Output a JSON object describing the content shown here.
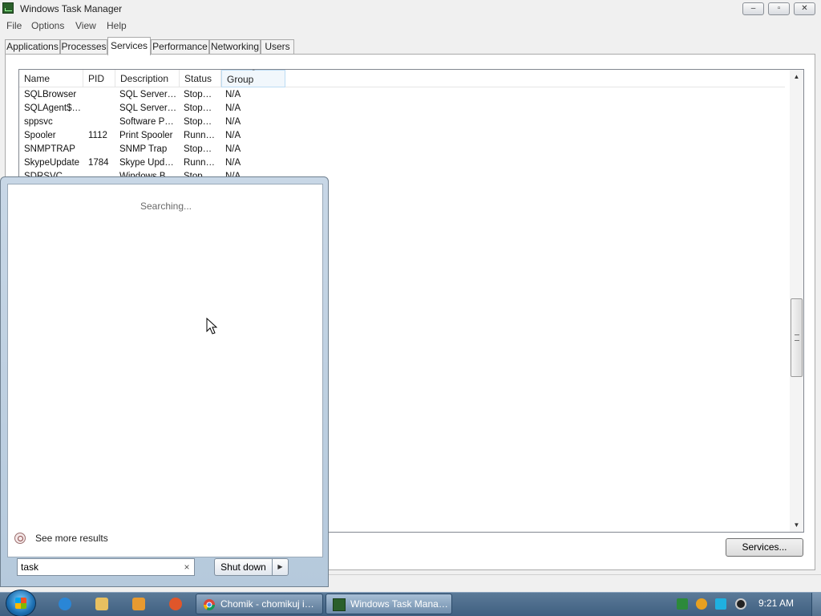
{
  "window": {
    "title": "Windows Task Manager",
    "min_label": "–",
    "max_label": "▫",
    "close_label": "✕"
  },
  "menu": [
    "File",
    "Options",
    "View",
    "Help"
  ],
  "tabs": [
    "Applications",
    "Processes",
    "Services",
    "Performance",
    "Networking",
    "Users"
  ],
  "active_tab": "Services",
  "table": {
    "columns": [
      "Name",
      "PID",
      "Description",
      "Status",
      "Group"
    ],
    "sorted_column": "Group",
    "sort_arrow": "ˆ",
    "rows": [
      [
        "SQLBrowser",
        "",
        "SQL Server…",
        "Stop…",
        "N/A"
      ],
      [
        "SQLAgent$…",
        "",
        "SQL Server…",
        "Stop…",
        "N/A"
      ],
      [
        "sppsvc",
        "",
        "Software P…",
        "Stop…",
        "N/A"
      ],
      [
        "Spooler",
        "1112",
        "Print Spooler",
        "Runn…",
        "N/A"
      ],
      [
        "SNMPTRAP",
        "",
        "SNMP Trap",
        "Stop…",
        "N/A"
      ],
      [
        "SkypeUpdate",
        "1784",
        "Skype Upd…",
        "Runn…",
        "N/A"
      ],
      [
        "SDRSVC",
        "",
        "Windows B…",
        "Stop…",
        "N/A"
      ]
    ]
  },
  "scrollbar": {
    "up": "▲",
    "down": "▼"
  },
  "services_button": "Services...",
  "start_menu": {
    "searching": "Searching...",
    "see_more": "See more results",
    "search_value": "task",
    "clear": "×",
    "shutdown": "Shut down",
    "shutdown_arrow": "▶"
  },
  "taskbar": {
    "tasks": [
      {
        "label": "Chomik - chomikuj i…",
        "icon": "chrome-icon"
      },
      {
        "label": "Windows Task Mana…",
        "icon": "task-manager-icon"
      }
    ],
    "pinned": [
      "internet-explorer-icon",
      "explorer-folder-icon",
      "media-player-icon",
      "app-icon"
    ],
    "tray": [
      "green-tray-icon",
      "search-tray-icon",
      "network-tray-icon",
      "volume-tray-icon"
    ],
    "clock": "9:21 AM"
  },
  "colors": {
    "taskbar": "#4a6a8a",
    "accent": "#1d6fb2"
  }
}
